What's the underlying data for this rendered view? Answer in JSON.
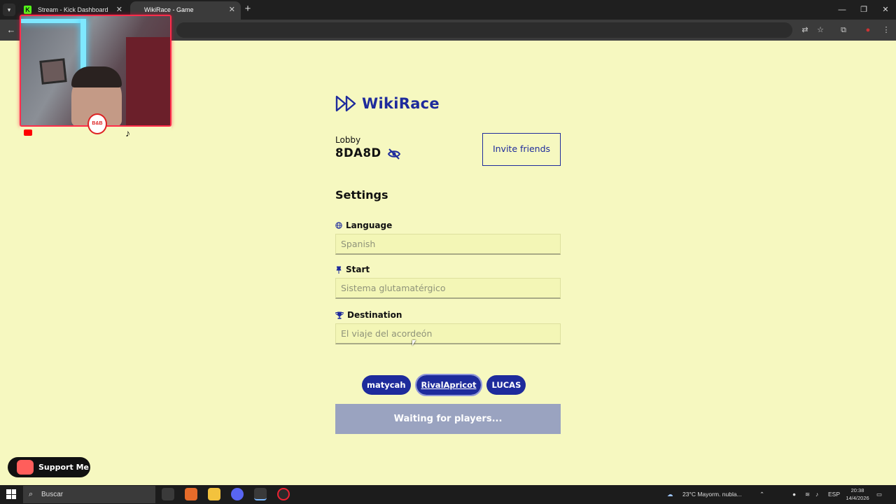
{
  "browser": {
    "tabs": [
      {
        "label": "Stream - Kick Dashboard",
        "favicon": "K"
      },
      {
        "label": "WikiRace - Game"
      }
    ],
    "new_tab": "+",
    "window_controls": {
      "minimize": "—",
      "maximize": "❐",
      "close": "✕"
    }
  },
  "stream_overlay": {
    "badge_text": "B&B",
    "tiktok_glyph": "♪"
  },
  "brand": {
    "name": "WikiRace",
    "color": "#1e2b9c"
  },
  "lobby": {
    "label": "Lobby",
    "code": "8DA8D",
    "invite_button": "Invite friends"
  },
  "settings": {
    "title": "Settings",
    "language": {
      "label": "Language",
      "icon": "globe-icon",
      "value": "Spanish"
    },
    "start": {
      "label": "Start",
      "icon": "pin-icon",
      "value": "Sistema glutamatérgico"
    },
    "destination": {
      "label": "Destination",
      "icon": "trophy-icon",
      "value": "El viaje del acordeón"
    }
  },
  "players": [
    {
      "name": "matycah"
    },
    {
      "name": "RivalApricot"
    },
    {
      "name": "LUCAS"
    }
  ],
  "waiting_button": "Waiting for players...",
  "support_button": "Support Me",
  "taskbar": {
    "search_placeholder": "Buscar",
    "weather": "23°C  Mayorm. nubla...",
    "language": "ESP",
    "time": "20:38",
    "date": "14/4/2026"
  },
  "colors": {
    "page_background": "#f6f8c0",
    "accent": "#1e2b9c",
    "waiting_button": "#9aa3c0"
  }
}
